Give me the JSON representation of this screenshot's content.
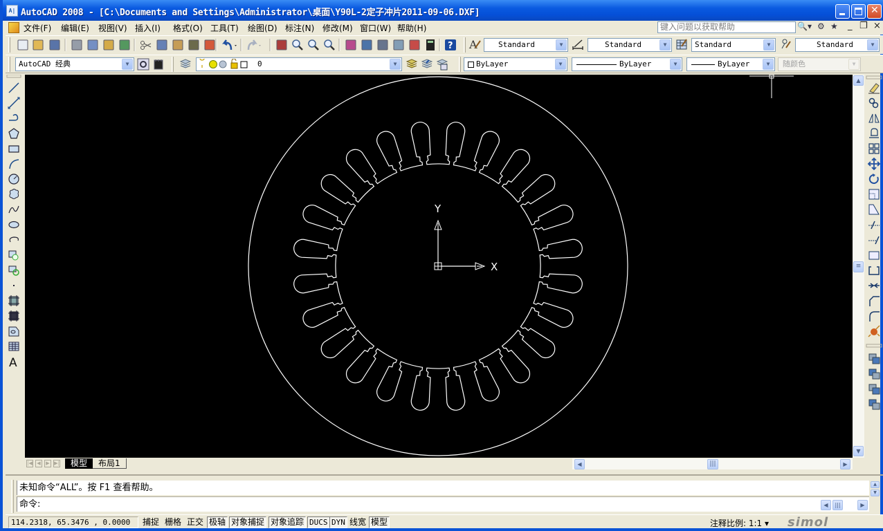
{
  "window": {
    "app_icon_text": "A|",
    "title": "AutoCAD 2008 - [C:\\Documents and Settings\\Administrator\\桌面\\Y90L-2定子冲片2011-09-06.DXF]",
    "controls": {
      "minimize": "_",
      "maximize": "□",
      "close": "X"
    }
  },
  "menu": {
    "items": [
      {
        "label": "文件(F)"
      },
      {
        "label": "编辑(E)"
      },
      {
        "label": "视图(V)"
      },
      {
        "label": "插入(I)"
      },
      {
        "label": "格式(O)"
      },
      {
        "label": "工具(T)"
      },
      {
        "label": "绘图(D)"
      },
      {
        "label": "标注(N)"
      },
      {
        "label": "修改(M)"
      },
      {
        "label": "窗口(W)"
      },
      {
        "label": "帮助(H)"
      }
    ],
    "help_placeholder": "键入问题以获取帮助",
    "doc_controls": {
      "minimize": "_",
      "restore": "❐",
      "close": "×"
    }
  },
  "toolbar_standard": {
    "icons": [
      "new-icon",
      "open-icon",
      "save-icon",
      "plot-icon",
      "plot-preview-icon",
      "publish-icon",
      "3d-dwf-icon",
      "cut-icon",
      "copy-icon",
      "paste-icon",
      "match-properties-icon",
      "block-editor-icon",
      "undo-icon",
      "redo-icon",
      "pan-icon",
      "zoom-realtime-icon",
      "zoom-window-icon",
      "zoom-previous-icon",
      "properties-icon",
      "design-center-icon",
      "tool-palettes-icon",
      "sheet-set-icon",
      "markup-icon",
      "quickcalc-icon",
      "help-icon"
    ]
  },
  "toolbar_styles": {
    "text_style": "Standard",
    "dim_style": "Standard",
    "table_style": "Standard",
    "multileader_style": "Standard"
  },
  "toolbar_workspace": {
    "workspace": "AutoCAD 经典"
  },
  "toolbar_layers": {
    "current_layer": "0"
  },
  "toolbar_properties": {
    "color": "ByLayer",
    "linetype": "ByLayer",
    "lineweight": "ByLayer",
    "plotstyle": "随颜色"
  },
  "draw_toolbar": {
    "tools": [
      "line",
      "construction-line",
      "polyline",
      "polygon",
      "rectangle",
      "arc",
      "circle",
      "revision-cloud",
      "spline",
      "ellipse",
      "ellipse-arc",
      "insert-block",
      "make-block",
      "point",
      "hatch",
      "gradient",
      "region",
      "table",
      "multiline-text"
    ]
  },
  "modify_toolbar": {
    "tools": [
      "erase",
      "copy",
      "mirror",
      "offset",
      "array",
      "move",
      "rotate",
      "scale",
      "stretch",
      "trim",
      "extend",
      "break-at-point",
      "break",
      "join",
      "chamfer",
      "fillet",
      "explode"
    ]
  },
  "draworder_toolbar": {
    "tools": [
      "bring-to-front",
      "send-to-back",
      "bring-above",
      "send-under"
    ]
  },
  "drawing": {
    "title": "Y90L-2 stator lamination",
    "slot_count": 24,
    "ucs": {
      "x_label": "X",
      "y_label": "Y"
    }
  },
  "layout_tabs": [
    {
      "label": "模型",
      "active": true
    },
    {
      "label": "布局1",
      "active": false
    }
  ],
  "command": {
    "history": "未知命令“ALL”。按 F1 查看帮助。",
    "prompt": "命令:"
  },
  "status": {
    "coords": "114.2318, 65.3476 , 0.0000",
    "toggles": [
      {
        "label": "捕捉",
        "on": false
      },
      {
        "label": "栅格",
        "on": false
      },
      {
        "label": "正交",
        "on": false
      },
      {
        "label": "极轴",
        "on": true
      },
      {
        "label": "对象捕捉",
        "on": true
      },
      {
        "label": "对象追踪",
        "on": true
      },
      {
        "label": "DUCS",
        "on": true
      },
      {
        "label": "DYN",
        "on": true
      },
      {
        "label": "线宽",
        "on": false
      },
      {
        "label": "模型",
        "on": true
      }
    ],
    "annotation_scale_label": "注释比例:",
    "annotation_scale": "1:1",
    "watermark": "simol"
  }
}
